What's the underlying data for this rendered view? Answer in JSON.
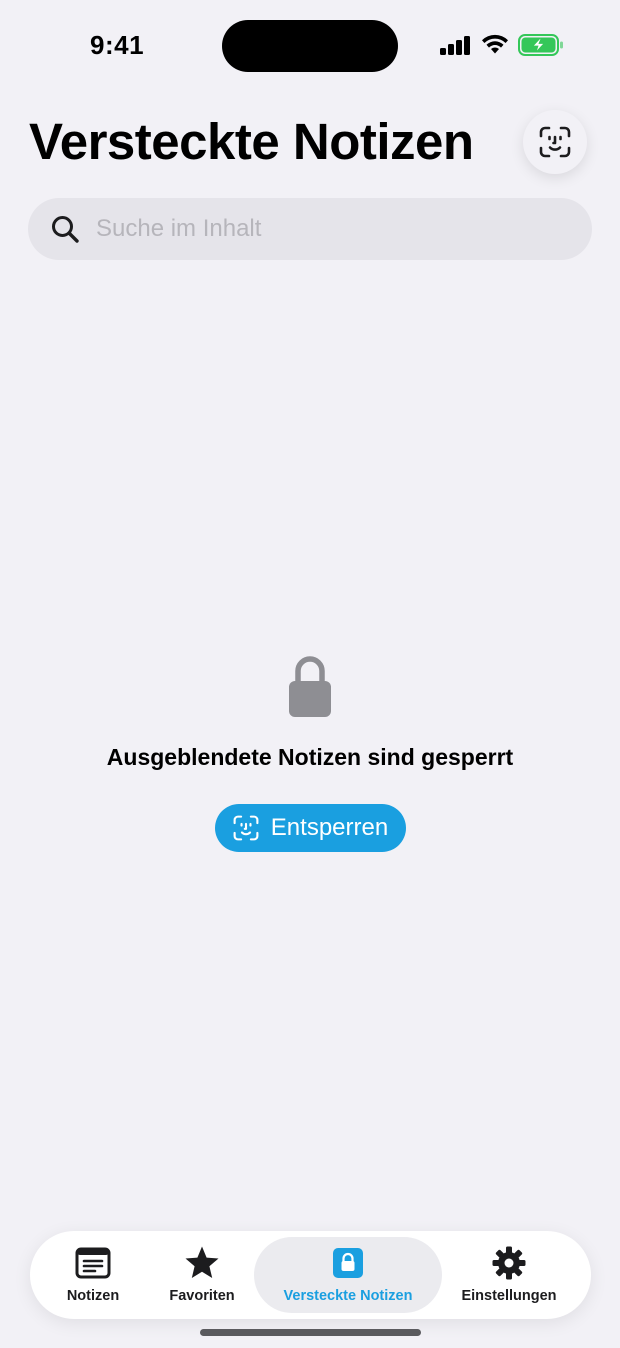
{
  "status_bar": {
    "time": "9:41"
  },
  "header": {
    "title": "Versteckte Notizen"
  },
  "search": {
    "placeholder": "Suche im Inhalt",
    "value": ""
  },
  "empty_state": {
    "message": "Ausgeblendete Notizen sind gesperrt",
    "unlock_label": "Entsperren"
  },
  "tabbar": {
    "tabs": [
      {
        "label": "Notizen",
        "icon": "note-list-icon"
      },
      {
        "label": "Favoriten",
        "icon": "star-icon"
      },
      {
        "label": "Versteckte Notizen",
        "icon": "lock-icon",
        "active": true
      },
      {
        "label": "Einstellungen",
        "icon": "gear-icon"
      }
    ]
  },
  "colors": {
    "accent": "#1a9fe0",
    "background": "#f2f1f6",
    "battery_green": "#34c759",
    "lock_gray": "#8e8e93"
  }
}
